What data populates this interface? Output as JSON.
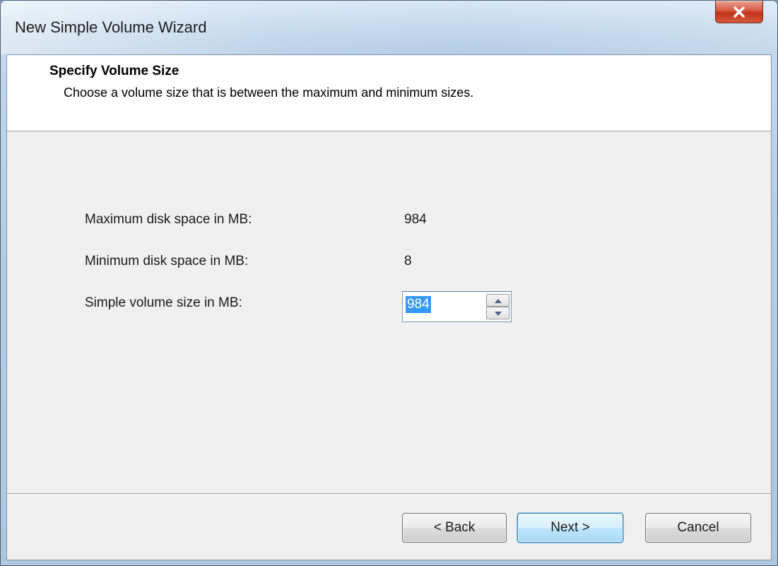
{
  "window": {
    "title": "New Simple Volume Wizard"
  },
  "header": {
    "title": "Specify Volume Size",
    "subtitle": "Choose a volume size that is between the maximum and minimum sizes."
  },
  "fields": {
    "max_label": "Maximum disk space in MB:",
    "max_value": "984",
    "min_label": "Minimum disk space in MB:",
    "min_value": "8",
    "size_label": "Simple volume size in MB:",
    "size_value": "984"
  },
  "buttons": {
    "back": "< Back",
    "next": "Next >",
    "cancel": "Cancel"
  },
  "icons": {
    "close": "close-icon",
    "spin_up": "chevron-up-icon",
    "spin_down": "chevron-down-icon"
  },
  "colors": {
    "selection": "#3399ff",
    "close_button": "#c0331b",
    "default_button_border": "#3c7fb1"
  }
}
